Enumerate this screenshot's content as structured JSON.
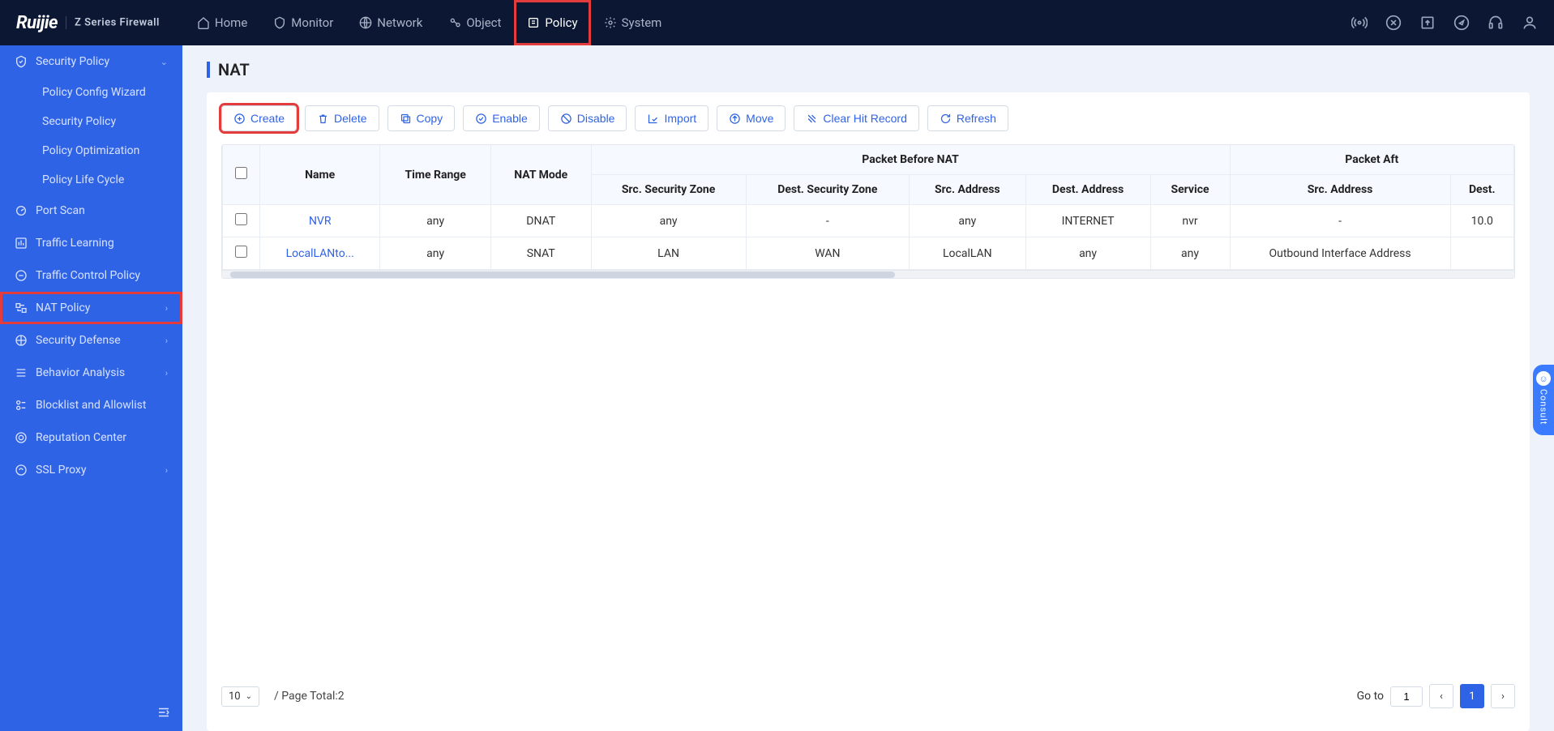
{
  "brand": {
    "logo": "Ruijie",
    "product": "Z Series Firewall"
  },
  "topnav": [
    {
      "label": "Home"
    },
    {
      "label": "Monitor"
    },
    {
      "label": "Network"
    },
    {
      "label": "Object"
    },
    {
      "label": "Policy",
      "highlighted": true
    },
    {
      "label": "System"
    }
  ],
  "sidebar": {
    "groups": [
      {
        "label": "Security Policy",
        "expanded": true,
        "children": [
          {
            "label": "Policy Config Wizard"
          },
          {
            "label": "Security Policy"
          },
          {
            "label": "Policy Optimization"
          },
          {
            "label": "Policy Life Cycle"
          }
        ]
      },
      {
        "label": "Port Scan"
      },
      {
        "label": "Traffic Learning"
      },
      {
        "label": "Traffic Control Policy"
      },
      {
        "label": "NAT Policy",
        "has_chev": true,
        "highlighted": true
      },
      {
        "label": "Security Defense",
        "has_chev": true
      },
      {
        "label": "Behavior Analysis",
        "has_chev": true
      },
      {
        "label": "Blocklist and Allowlist"
      },
      {
        "label": "Reputation Center"
      },
      {
        "label": "SSL Proxy",
        "has_chev": true
      }
    ]
  },
  "page": {
    "title": "NAT"
  },
  "toolbar": [
    {
      "key": "create",
      "label": "Create",
      "highlighted": true
    },
    {
      "key": "delete",
      "label": "Delete"
    },
    {
      "key": "copy",
      "label": "Copy"
    },
    {
      "key": "enable",
      "label": "Enable"
    },
    {
      "key": "disable",
      "label": "Disable"
    },
    {
      "key": "import",
      "label": "Import"
    },
    {
      "key": "move",
      "label": "Move"
    },
    {
      "key": "clear",
      "label": "Clear Hit Record"
    },
    {
      "key": "refresh",
      "label": "Refresh"
    }
  ],
  "table": {
    "group_headers": {
      "before": "Packet Before NAT",
      "after": "Packet Aft"
    },
    "columns": [
      "Name",
      "Time Range",
      "NAT Mode",
      "Src. Security Zone",
      "Dest. Security Zone",
      "Src. Address",
      "Dest. Address",
      "Service",
      "Src. Address",
      "Dest."
    ],
    "rows": [
      {
        "name": "NVR",
        "time_range": "any",
        "mode": "DNAT",
        "src_zone": "any",
        "dest_zone": "-",
        "src_addr": "any",
        "dest_addr": "INTERNET",
        "service": "nvr",
        "after_src": "-",
        "after_dest": "10.0"
      },
      {
        "name": "LocalLANto...",
        "time_range": "any",
        "mode": "SNAT",
        "src_zone": "LAN",
        "dest_zone": "WAN",
        "src_addr": "LocalLAN",
        "dest_addr": "any",
        "service": "any",
        "after_src": "Outbound Interface Address",
        "after_dest": ""
      }
    ]
  },
  "footer": {
    "page_size": "10",
    "page_total_label": "/ Page Total:2",
    "goto_label": "Go to",
    "goto_value": "1",
    "current_page": "1"
  },
  "consult": {
    "label": "Consult"
  }
}
